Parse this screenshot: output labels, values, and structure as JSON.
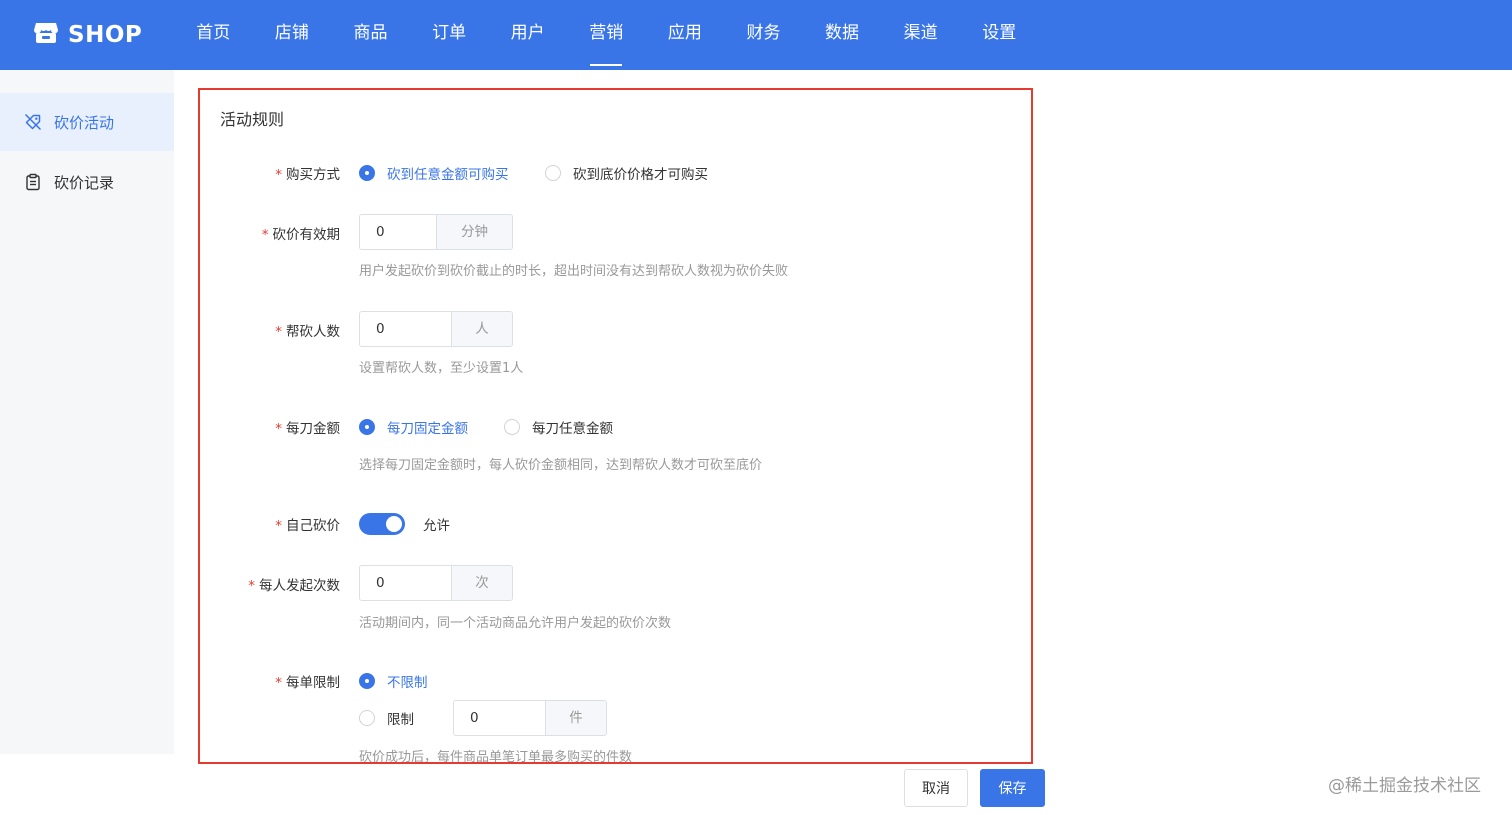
{
  "header": {
    "logo_text": "SHOP",
    "nav": [
      "首页",
      "店铺",
      "商品",
      "订单",
      "用户",
      "营销",
      "应用",
      "财务",
      "数据",
      "渠道",
      "设置"
    ],
    "active_nav": "营销"
  },
  "sidebar": {
    "items": [
      {
        "label": "砍价活动",
        "icon": "tag-off-icon",
        "active": true
      },
      {
        "label": "砍价记录",
        "icon": "clipboard-icon",
        "active": false
      }
    ]
  },
  "panel": {
    "title": "活动规则",
    "purchase_mode": {
      "label": "购买方式",
      "options": [
        "砍到任意金额可购买",
        "砍到底价价格才可购买"
      ],
      "selected": "砍到任意金额可购买"
    },
    "validity": {
      "label": "砍价有效期",
      "value": "0",
      "unit": "分钟",
      "hint": "用户发起砍价到砍价截止的时长，超出时间没有达到帮砍人数视为砍价失败"
    },
    "helpers": {
      "label": "帮砍人数",
      "value": "0",
      "unit": "人",
      "hint": "设置帮砍人数，至少设置1人"
    },
    "per_cut_amount": {
      "label": "每刀金额",
      "options": [
        "每刀固定金额",
        "每刀任意金额"
      ],
      "selected": "每刀固定金额",
      "hint": "选择每刀固定金额时，每人砍价金额相同，达到帮砍人数才可砍至底价"
    },
    "self_cut": {
      "label": "自己砍价",
      "enabled": true,
      "state_text": "允许"
    },
    "launch_times": {
      "label": "每人发起次数",
      "value": "0",
      "unit": "次",
      "hint": "活动期间内，同一个活动商品允许用户发起的砍价次数"
    },
    "order_limit": {
      "label": "每单限制",
      "options": [
        "不限制",
        "限制"
      ],
      "selected": "不限制",
      "limit_value": "0",
      "limit_unit": "件",
      "hint": "砍价成功后，每件商品单笔订单最多购买的件数"
    }
  },
  "footer": {
    "cancel_label": "取消",
    "save_label": "保存"
  },
  "watermark": "@稀土掘金技术社区",
  "colors": {
    "primary": "#3a75e8",
    "danger": "#e53a2f",
    "hint": "#999999"
  }
}
